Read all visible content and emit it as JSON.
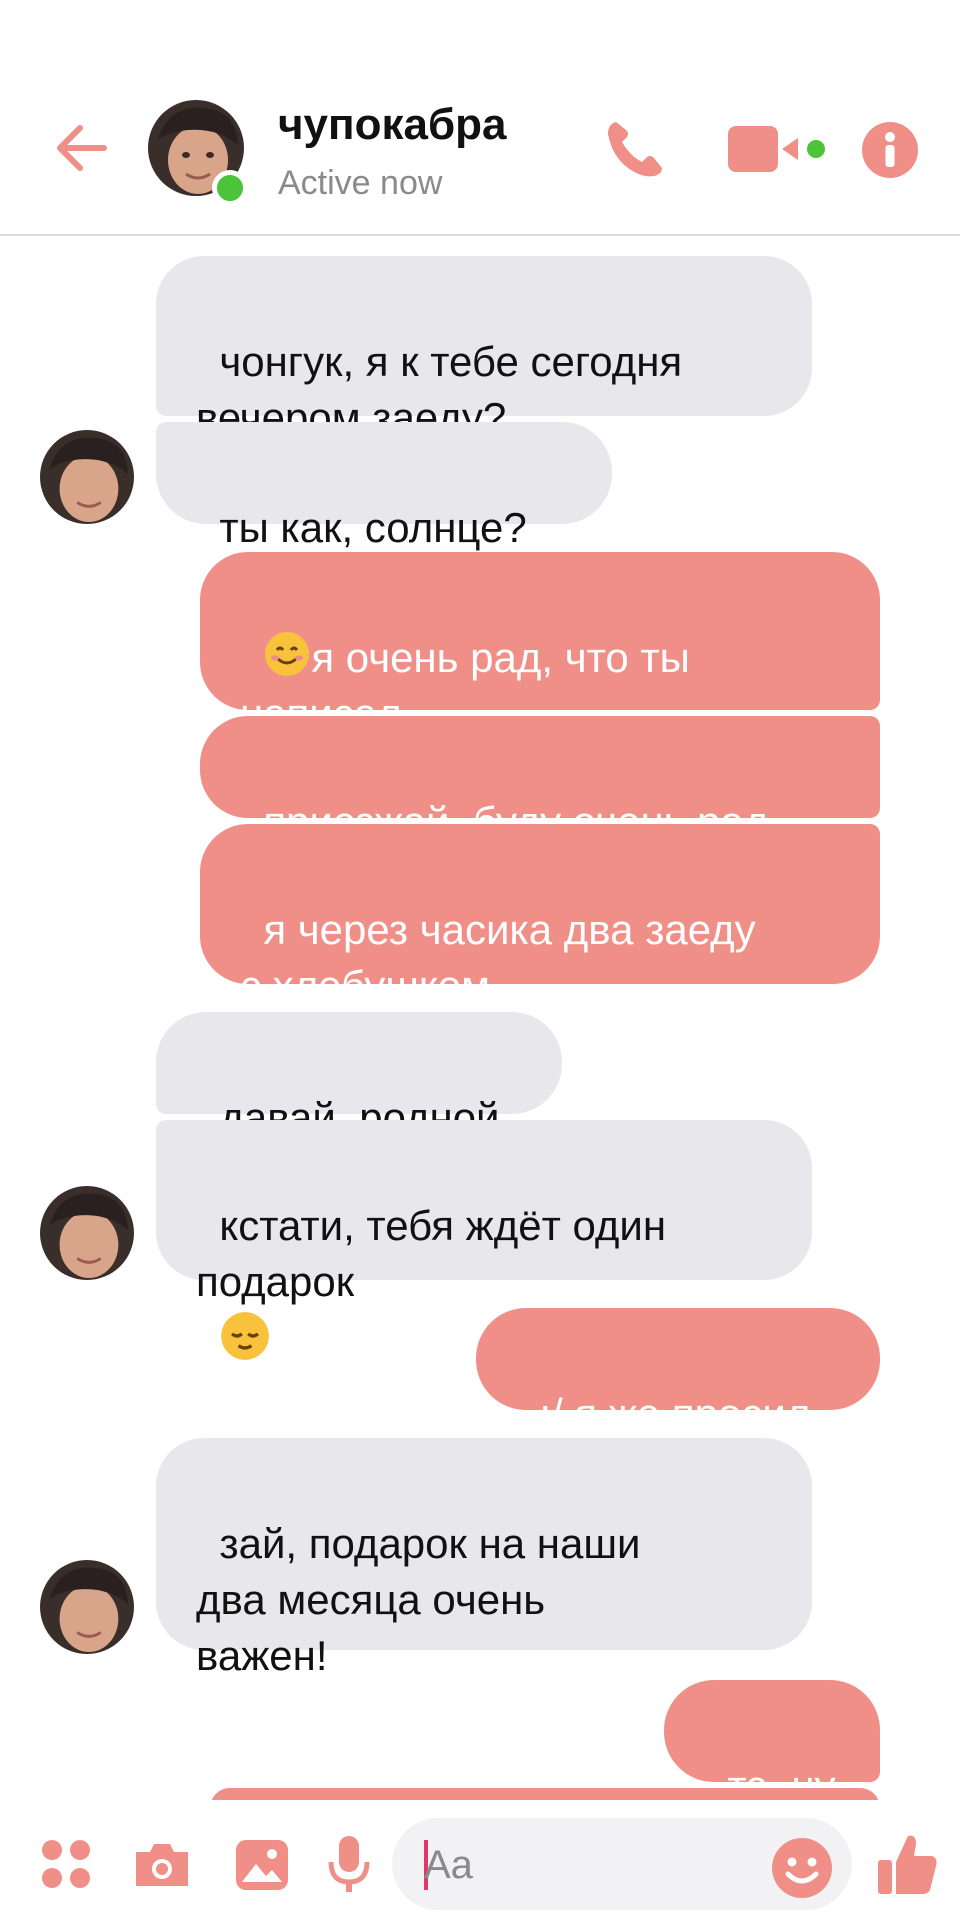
{
  "colors": {
    "accent": "#ef8f87",
    "incoming_bubble": "#e8e7ec",
    "online": "#4bc43a"
  },
  "header": {
    "contact_name": "чупокабра",
    "status": "Active now",
    "icons": [
      "back-arrow-icon",
      "phone-icon",
      "video-camera-icon",
      "info-icon"
    ]
  },
  "messages": [
    {
      "direction": "in",
      "text": "чонгук, я к тебе сегодня\nвечером заеду?"
    },
    {
      "direction": "in",
      "text": "ты как, солнце?"
    },
    {
      "direction": "out",
      "emoji": "smiling-face-icon",
      "text": "я очень рад, что ты\nнаписал"
    },
    {
      "direction": "out",
      "text": "приезжай, буду очень рад"
    },
    {
      "direction": "out",
      "text": "я через часика два заеду\nс хлебушком"
    },
    {
      "direction": "in",
      "text": "давай, родной"
    },
    {
      "direction": "in",
      "text": "кстати, тебя ждёт один\nподарок",
      "emoji": "relieved-face-icon"
    },
    {
      "direction": "out",
      "text": ":/ я же просил"
    },
    {
      "direction": "in",
      "text": "зай, подарок на наши\nдва месяца очень\nважен!"
    },
    {
      "direction": "out",
      "text": "тэ, ну"
    }
  ],
  "composer": {
    "placeholder": "Aa",
    "icons": [
      "apps-icon",
      "camera-icon",
      "gallery-icon",
      "microphone-icon",
      "emoji-icon",
      "thumbs-up-icon"
    ]
  }
}
